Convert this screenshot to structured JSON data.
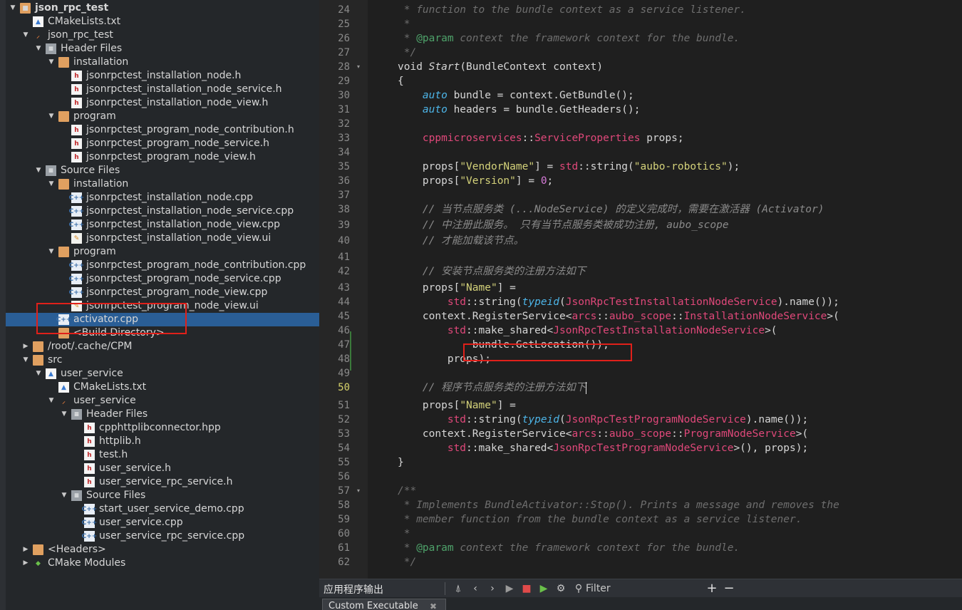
{
  "tree": [
    {
      "label": "json_rpc_test",
      "icon": "project-icon",
      "arrow": "down",
      "bold": true
    },
    {
      "label": "CMakeLists.txt",
      "icon": "cmake-file-icon",
      "arrow": ""
    },
    {
      "label": "json_rpc_test",
      "icon": "subproject-icon",
      "arrow": "down"
    },
    {
      "label": "Header Files",
      "icon": "file-group-icon",
      "arrow": "down"
    },
    {
      "label": "installation",
      "icon": "folder-icon",
      "arrow": "down"
    },
    {
      "label": "jsonrpctest_installation_node.h",
      "icon": "header-file-icon",
      "arrow": ""
    },
    {
      "label": "jsonrpctest_installation_node_service.h",
      "icon": "header-file-icon",
      "arrow": ""
    },
    {
      "label": "jsonrpctest_installation_node_view.h",
      "icon": "header-file-icon",
      "arrow": ""
    },
    {
      "label": "program",
      "icon": "folder-icon",
      "arrow": "down"
    },
    {
      "label": "jsonrpctest_program_node_contribution.h",
      "icon": "header-file-icon",
      "arrow": ""
    },
    {
      "label": "jsonrpctest_program_node_service.h",
      "icon": "header-file-icon",
      "arrow": ""
    },
    {
      "label": "jsonrpctest_program_node_view.h",
      "icon": "header-file-icon",
      "arrow": ""
    },
    {
      "label": "Source Files",
      "icon": "file-group-icon",
      "arrow": "down"
    },
    {
      "label": "installation",
      "icon": "folder-icon",
      "arrow": "down"
    },
    {
      "label": "jsonrpctest_installation_node.cpp",
      "icon": "cpp-file-icon",
      "arrow": ""
    },
    {
      "label": "jsonrpctest_installation_node_service.cpp",
      "icon": "cpp-file-icon",
      "arrow": ""
    },
    {
      "label": "jsonrpctest_installation_node_view.cpp",
      "icon": "cpp-file-icon",
      "arrow": ""
    },
    {
      "label": "jsonrpctest_installation_node_view.ui",
      "icon": "ui-file-icon",
      "arrow": ""
    },
    {
      "label": "program",
      "icon": "folder-icon",
      "arrow": "down"
    },
    {
      "label": "jsonrpctest_program_node_contribution.cpp",
      "icon": "cpp-file-icon",
      "arrow": ""
    },
    {
      "label": "jsonrpctest_program_node_service.cpp",
      "icon": "cpp-file-icon",
      "arrow": ""
    },
    {
      "label": "jsonrpctest_program_node_view.cpp",
      "icon": "cpp-file-icon",
      "arrow": ""
    },
    {
      "label": "jsonrpctest_program_node_view.ui",
      "icon": "ui-file-icon",
      "arrow": ""
    },
    {
      "label": "activator.cpp",
      "icon": "cpp-file-icon",
      "arrow": "",
      "selected": true
    },
    {
      "label": "<Build Directory>",
      "icon": "folder-icon",
      "arrow": ""
    },
    {
      "label": "/root/.cache/CPM",
      "icon": "folder-icon",
      "arrow": "right"
    },
    {
      "label": "src",
      "icon": "folder-icon",
      "arrow": "down"
    },
    {
      "label": "user_service",
      "icon": "cmake-project-icon",
      "arrow": "down"
    },
    {
      "label": "CMakeLists.txt",
      "icon": "cmake-file-icon",
      "arrow": ""
    },
    {
      "label": "user_service",
      "icon": "subproject-icon",
      "arrow": "down"
    },
    {
      "label": "Header Files",
      "icon": "file-group-icon",
      "arrow": "down"
    },
    {
      "label": "cpphttplibconnector.hpp",
      "icon": "header-file-icon",
      "arrow": ""
    },
    {
      "label": "httplib.h",
      "icon": "header-file-icon",
      "arrow": ""
    },
    {
      "label": "test.h",
      "icon": "header-file-icon",
      "arrow": ""
    },
    {
      "label": "user_service.h",
      "icon": "header-file-icon",
      "arrow": ""
    },
    {
      "label": "user_service_rpc_service.h",
      "icon": "header-file-icon",
      "arrow": ""
    },
    {
      "label": "Source Files",
      "icon": "file-group-icon",
      "arrow": "down"
    },
    {
      "label": "start_user_service_demo.cpp",
      "icon": "cpp-file-icon",
      "arrow": ""
    },
    {
      "label": "user_service.cpp",
      "icon": "cpp-file-icon",
      "arrow": ""
    },
    {
      "label": "user_service_rpc_service.cpp",
      "icon": "cpp-file-icon",
      "arrow": ""
    },
    {
      "label": "<Headers>",
      "icon": "folder-icon",
      "arrow": "right"
    },
    {
      "label": "CMake Modules",
      "icon": "cmake-modules-icon",
      "arrow": "right"
    }
  ],
  "editor": {
    "current_line": "50",
    "lines": [
      {
        "n": "24",
        "segs": [
          [
            " * function to the bundle context as a service listener.",
            "cm"
          ]
        ]
      },
      {
        "n": "25",
        "segs": [
          [
            " *",
            "cm"
          ]
        ]
      },
      {
        "n": "26",
        "segs": [
          [
            " * ",
            "cm"
          ],
          [
            "@param",
            "doc"
          ],
          [
            " context the framework context for the bundle.",
            "cm"
          ]
        ]
      },
      {
        "n": "27",
        "segs": [
          [
            " */",
            "cm"
          ]
        ]
      },
      {
        "n": "28",
        "fold": "down",
        "segs": [
          [
            "void ",
            "kw"
          ],
          [
            "Start",
            "fn"
          ],
          [
            "(BundleContext context)",
            ""
          ]
        ]
      },
      {
        "n": "29",
        "segs": [
          [
            "{",
            ""
          ]
        ]
      },
      {
        "n": "30",
        "segs": [
          [
            "    ",
            ""
          ],
          [
            "auto",
            "ital"
          ],
          [
            " bundle = context.GetBundle();",
            ""
          ]
        ]
      },
      {
        "n": "31",
        "segs": [
          [
            "    ",
            ""
          ],
          [
            "auto",
            "ital"
          ],
          [
            " headers = bundle.GetHeaders();",
            ""
          ]
        ]
      },
      {
        "n": "32",
        "segs": []
      },
      {
        "n": "33",
        "segs": [
          [
            "    ",
            ""
          ],
          [
            "cppmicroservices",
            "ns"
          ],
          [
            "::",
            ""
          ],
          [
            "ServiceProperties",
            "ty"
          ],
          [
            " props;",
            ""
          ]
        ]
      },
      {
        "n": "34",
        "segs": []
      },
      {
        "n": "35",
        "segs": [
          [
            "    props[",
            ""
          ],
          [
            "\"VendorName\"",
            "str"
          ],
          [
            "] = ",
            ""
          ],
          [
            "std",
            "ns"
          ],
          [
            "::string(",
            ""
          ],
          [
            "\"aubo-robotics\"",
            "str"
          ],
          [
            ");",
            ""
          ]
        ]
      },
      {
        "n": "36",
        "segs": [
          [
            "    props[",
            ""
          ],
          [
            "\"Version\"",
            "str"
          ],
          [
            "] = ",
            ""
          ],
          [
            "0",
            "num"
          ],
          [
            ";",
            ""
          ]
        ]
      },
      {
        "n": "37",
        "segs": []
      },
      {
        "n": "38",
        "segs": [
          [
            "    ",
            ""
          ],
          [
            "// 当节点服务类 (...NodeService) 的定义完成时，需要在激活器 (Activator)",
            "cn"
          ]
        ]
      },
      {
        "n": "39",
        "segs": [
          [
            "    ",
            ""
          ],
          [
            "// 中注册此服务。 只有当节点服务类被成功注册, aubo_scope",
            "cn"
          ]
        ]
      },
      {
        "n": "40",
        "segs": [
          [
            "    ",
            ""
          ],
          [
            "// 才能加载该节点。",
            "cn"
          ]
        ]
      },
      {
        "n": "41",
        "segs": []
      },
      {
        "n": "42",
        "segs": [
          [
            "    ",
            ""
          ],
          [
            "// 安装节点服务类的注册方法如下",
            "cn"
          ]
        ]
      },
      {
        "n": "43",
        "segs": [
          [
            "    props[",
            ""
          ],
          [
            "\"Name\"",
            "str"
          ],
          [
            "] =",
            ""
          ]
        ]
      },
      {
        "n": "44",
        "segs": [
          [
            "        ",
            ""
          ],
          [
            "std",
            "ns"
          ],
          [
            "::string(",
            ""
          ],
          [
            "typeid",
            "ital"
          ],
          [
            "(",
            ""
          ],
          [
            "JsonRpcTestInstallationNodeService",
            "ty"
          ],
          [
            ").name());",
            ""
          ]
        ]
      },
      {
        "n": "45",
        "segs": [
          [
            "    context.RegisterService<",
            ""
          ],
          [
            "arcs",
            "ns"
          ],
          [
            "::",
            ""
          ],
          [
            "aubo_scope",
            "ns"
          ],
          [
            "::",
            ""
          ],
          [
            "InstallationNodeService",
            "ty"
          ],
          [
            ">(",
            ""
          ]
        ]
      },
      {
        "n": "46",
        "segs": [
          [
            "        ",
            ""
          ],
          [
            "std",
            "ns"
          ],
          [
            "::make_shared<",
            ""
          ],
          [
            "JsonRpcTestInstallationNodeService",
            "ty"
          ],
          [
            ">(",
            ""
          ]
        ]
      },
      {
        "n": "47",
        "segs": [
          [
            "            bundle.GetLocation()),",
            ""
          ]
        ]
      },
      {
        "n": "48",
        "segs": [
          [
            "        props);",
            ""
          ]
        ]
      },
      {
        "n": "49",
        "segs": []
      },
      {
        "n": "50",
        "cursor": true,
        "segs": [
          [
            "    ",
            ""
          ],
          [
            "// 程序节点服务类的注册方法如下",
            "cn"
          ]
        ]
      },
      {
        "n": "51",
        "segs": [
          [
            "    props[",
            ""
          ],
          [
            "\"Name\"",
            "str"
          ],
          [
            "] =",
            ""
          ]
        ]
      },
      {
        "n": "52",
        "segs": [
          [
            "        ",
            ""
          ],
          [
            "std",
            "ns"
          ],
          [
            "::string(",
            ""
          ],
          [
            "typeid",
            "ital"
          ],
          [
            "(",
            ""
          ],
          [
            "JsonRpcTestProgramNodeService",
            "ty"
          ],
          [
            ").name());",
            ""
          ]
        ]
      },
      {
        "n": "53",
        "segs": [
          [
            "    context.RegisterService<",
            ""
          ],
          [
            "arcs",
            "ns"
          ],
          [
            "::",
            ""
          ],
          [
            "aubo_scope",
            "ns"
          ],
          [
            "::",
            ""
          ],
          [
            "ProgramNodeService",
            "ty"
          ],
          [
            ">(",
            ""
          ]
        ]
      },
      {
        "n": "54",
        "segs": [
          [
            "        ",
            ""
          ],
          [
            "std",
            "ns"
          ],
          [
            "::make_shared<",
            ""
          ],
          [
            "JsonRpcTestProgramNodeService",
            "ty"
          ],
          [
            ">(), props);",
            ""
          ]
        ]
      },
      {
        "n": "55",
        "segs": [
          [
            "}",
            ""
          ]
        ]
      },
      {
        "n": "56",
        "segs": []
      },
      {
        "n": "57",
        "fold": "down",
        "segs": [
          [
            "/**",
            "cm"
          ]
        ]
      },
      {
        "n": "58",
        "segs": [
          [
            " * Implements BundleActivator::Stop(). Prints a message and removes the",
            "cm"
          ]
        ]
      },
      {
        "n": "59",
        "segs": [
          [
            " * member function from the bundle context as a service listener.",
            "cm"
          ]
        ]
      },
      {
        "n": "60",
        "segs": [
          [
            " *",
            "cm"
          ]
        ]
      },
      {
        "n": "61",
        "segs": [
          [
            " * ",
            "cm"
          ],
          [
            "@param",
            "doc"
          ],
          [
            " context the framework context for the bundle.",
            "cm"
          ]
        ]
      },
      {
        "n": "62",
        "segs": [
          [
            " */",
            "cm"
          ]
        ]
      }
    ]
  },
  "output_bar": {
    "title": "应用程序输出",
    "filter_placeholder": "Filter",
    "add_label": "+",
    "remove_label": "−"
  },
  "tab": {
    "label": "Custom Executable",
    "close": "✖"
  },
  "colors": {
    "selection": "#2a5e96",
    "annotation_box": "#e0201a",
    "string": "#d4d27a",
    "type": "#e0487a",
    "keyword_italic": "#4db5e8"
  }
}
